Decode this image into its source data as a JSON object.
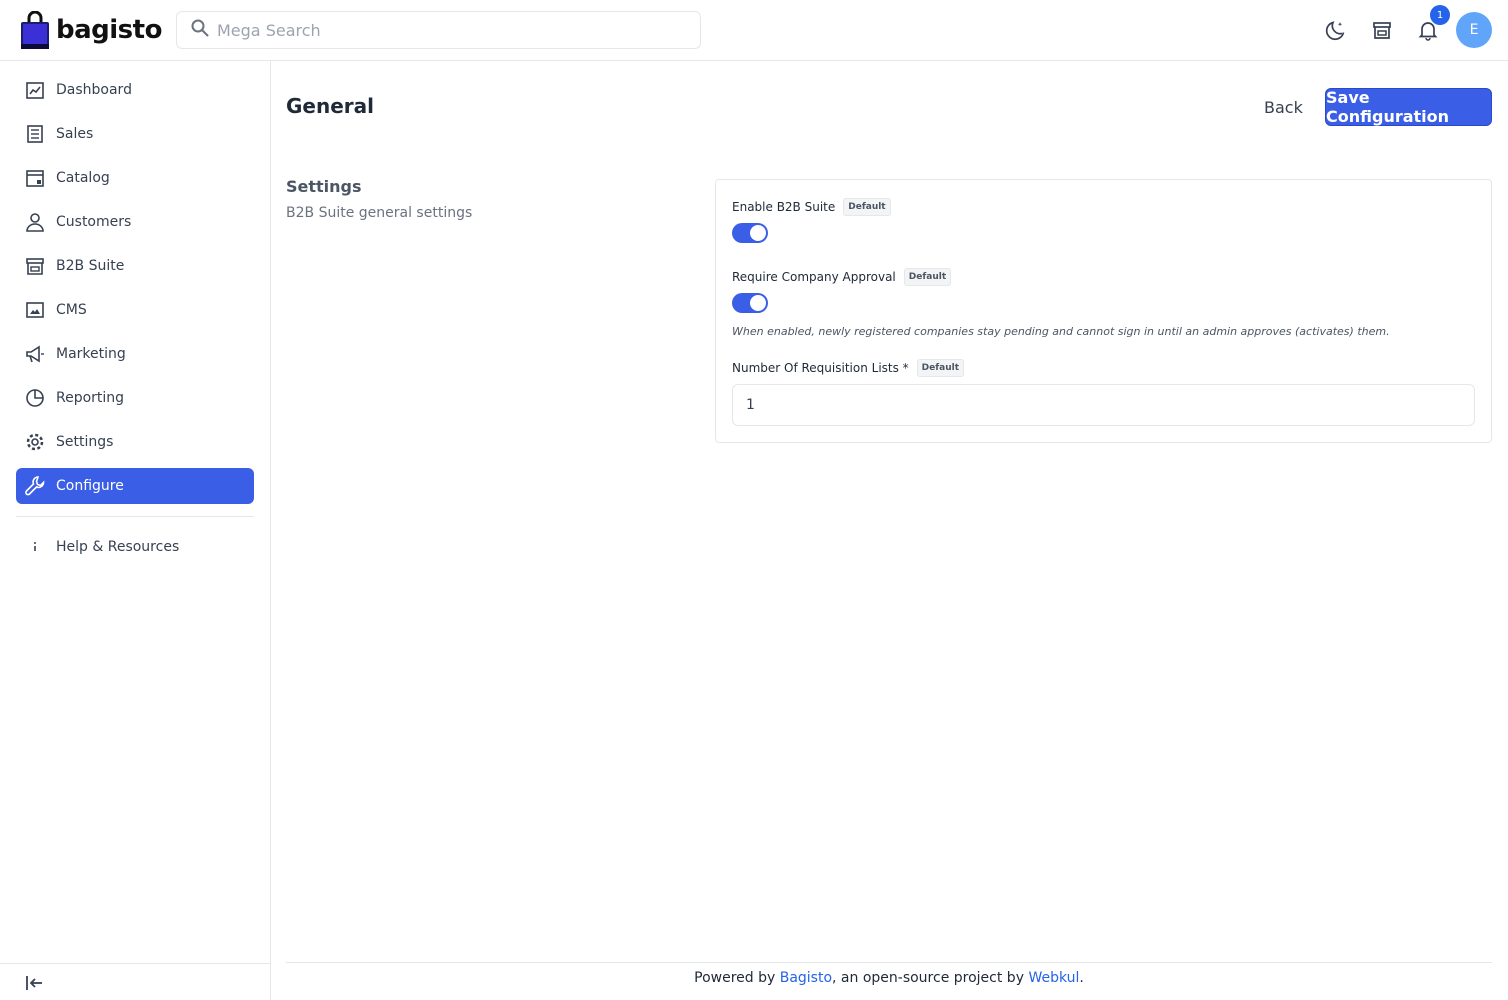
{
  "header": {
    "logo_text": "bagisto",
    "search_placeholder": "Mega Search",
    "notification_count": "1",
    "avatar_initial": "E"
  },
  "sidebar": {
    "items": [
      {
        "label": "Dashboard",
        "icon": "dashboard-icon"
      },
      {
        "label": "Sales",
        "icon": "sales-icon"
      },
      {
        "label": "Catalog",
        "icon": "catalog-icon"
      },
      {
        "label": "Customers",
        "icon": "customers-icon"
      },
      {
        "label": "B2B Suite",
        "icon": "store-icon"
      },
      {
        "label": "CMS",
        "icon": "cms-icon"
      },
      {
        "label": "Marketing",
        "icon": "megaphone-icon"
      },
      {
        "label": "Reporting",
        "icon": "pie-chart-icon"
      },
      {
        "label": "Settings",
        "icon": "gear-icon"
      },
      {
        "label": "Configure",
        "icon": "wrench-icon",
        "active": true
      }
    ],
    "help_label": "Help & Resources"
  },
  "main": {
    "title": "General",
    "back_label": "Back",
    "save_label": "Save Configuration",
    "section_title": "Settings",
    "section_desc": "B2B Suite general settings",
    "fields": {
      "enable_b2b": {
        "label": "Enable B2B Suite",
        "badge": "Default",
        "value": true
      },
      "require_approval": {
        "label": "Require Company Approval",
        "badge": "Default",
        "value": true,
        "help": "When enabled, newly registered companies stay pending and cannot sign in until an admin approves (activates) them."
      },
      "requisition_lists": {
        "label": "Number Of Requisition Lists *",
        "badge": "Default",
        "value": "1"
      }
    }
  },
  "footer": {
    "prefix": "Powered by ",
    "link1": "Bagisto",
    "middle": ", an open-source project by ",
    "link2": "Webkul",
    "suffix": "."
  },
  "colors": {
    "accent": "#3b5ee6",
    "link": "#2563eb",
    "avatar": "#60a5fa"
  }
}
